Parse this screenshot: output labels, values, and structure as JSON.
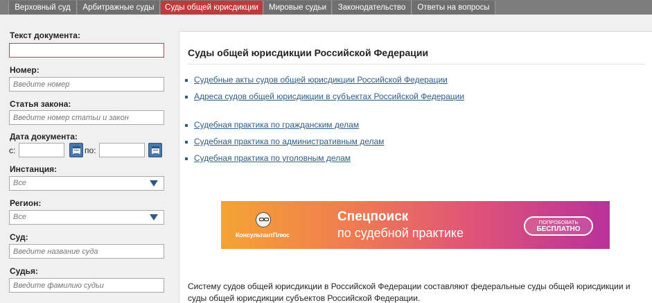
{
  "nav": {
    "tabs": [
      {
        "label": "Верховный суд"
      },
      {
        "label": "Арбитражные суды"
      },
      {
        "label": "Суды общей юрисдикции",
        "active": true
      },
      {
        "label": "Мировые судьи"
      },
      {
        "label": "Законодательство"
      },
      {
        "label": "Ответы на вопросы"
      }
    ]
  },
  "sidebar": {
    "doc_text_label": "Текст документа:",
    "doc_text_value": "",
    "number_label": "Номер:",
    "number_placeholder": "Введите номер",
    "law_article_label": "Статья закона:",
    "law_article_placeholder": "Введите номер статьи и закон",
    "doc_date_label": "Дата документа:",
    "date_from_label": "с:",
    "date_to_label": "по:",
    "instance_label": "Инстанция:",
    "instance_value": "Все",
    "region_label": "Регион:",
    "region_value": "Все",
    "court_label": "Суд:",
    "court_placeholder": "Введите название суда",
    "judge_label": "Судья:",
    "judge_placeholder": "Введите фамилию судьи"
  },
  "main": {
    "title": "Суды общей юрисдикции Российской Федерации",
    "links": [
      "Судебные акты судов общей юрисдикции Российской Федерации",
      "Адреса судов общей юрисдикции в субъектах Российской Федерации",
      "Судебная практика по гражданским делам",
      "Судебная практика по административным делам",
      "Судебная практика по уголовным делам"
    ],
    "banner": {
      "logo_text": "КонсультантПлюс",
      "headline": "Спецпоиск",
      "subline": "по судебной практике",
      "button_line1": "ПОПРОБОВАТЬ",
      "button_line2": "БЕСПЛАТНО"
    },
    "paragraph": "Систему судов общей юрисдикции в Российской Федерации составляют федеральные суды общей юрисдикции и суды общей юрисдикции субъектов Российской Федерации."
  },
  "colors": {
    "active_tab": "#c0393b",
    "tab_bg": "#6f6f6f",
    "link": "#2e5d87",
    "calendar_button": "#4a78a8"
  }
}
